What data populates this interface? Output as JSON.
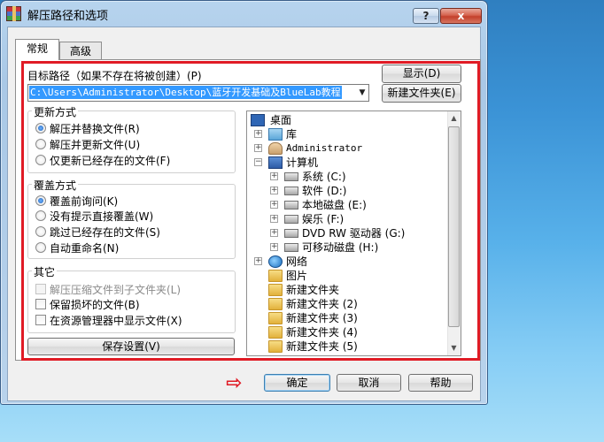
{
  "window": {
    "title": "解压路径和选项",
    "help_btn": "?",
    "close_btn": "x"
  },
  "tabs": [
    {
      "label": "常规",
      "active": true
    },
    {
      "label": "高级",
      "active": false
    }
  ],
  "target": {
    "label": "目标路径（如果不存在将被创建）(P)",
    "path": "C:\\Users\\Administrator\\Desktop\\蓝牙开发基础及BlueLab教程",
    "show_btn": "显示(D)",
    "new_folder_btn": "新建文件夹(E)"
  },
  "update_mode": {
    "title": "更新方式",
    "options": [
      {
        "label": "解压并替换文件(R)",
        "selected": true
      },
      {
        "label": "解压并更新文件(U)",
        "selected": false
      },
      {
        "label": "仅更新已经存在的文件(F)",
        "selected": false
      }
    ]
  },
  "overwrite_mode": {
    "title": "覆盖方式",
    "options": [
      {
        "label": "覆盖前询问(K)",
        "selected": true
      },
      {
        "label": "没有提示直接覆盖(W)",
        "selected": false
      },
      {
        "label": "跳过已经存在的文件(S)",
        "selected": false
      },
      {
        "label": "自动重命名(N)",
        "selected": false
      }
    ]
  },
  "misc": {
    "title": "其它",
    "options": [
      {
        "label": "解压压缩文件到子文件夹(L)",
        "disabled": true
      },
      {
        "label": "保留损坏的文件(B)",
        "disabled": false
      },
      {
        "label": "在资源管理器中显示文件(X)",
        "disabled": false
      }
    ]
  },
  "save_settings_btn": "保存设置(V)",
  "tree": [
    {
      "label": "桌面",
      "icon": "desktop-icon"
    },
    {
      "label": "库",
      "icon": "library-icon"
    },
    {
      "label": "Administrator",
      "icon": "user-folder-icon"
    },
    {
      "label": "计算机",
      "icon": "computer-icon"
    },
    {
      "label": "系统 (C:)",
      "icon": "drive-icon"
    },
    {
      "label": "软件 (D:)",
      "icon": "drive-icon"
    },
    {
      "label": "本地磁盘 (E:)",
      "icon": "drive-icon"
    },
    {
      "label": "娱乐 (F:)",
      "icon": "drive-icon"
    },
    {
      "label": "DVD RW 驱动器 (G:)",
      "icon": "dvd-drive-icon"
    },
    {
      "label": "可移动磁盘 (H:)",
      "icon": "removable-drive-icon"
    },
    {
      "label": "网络",
      "icon": "network-icon"
    },
    {
      "label": "图片",
      "icon": "folder-icon"
    },
    {
      "label": "新建文件夹",
      "icon": "folder-icon"
    },
    {
      "label": "新建文件夹 (2)",
      "icon": "folder-icon"
    },
    {
      "label": "新建文件夹 (3)",
      "icon": "folder-icon"
    },
    {
      "label": "新建文件夹 (4)",
      "icon": "folder-icon"
    },
    {
      "label": "新建文件夹 (5)",
      "icon": "folder-icon"
    }
  ],
  "footer": {
    "ok_btn": "确定",
    "cancel_btn": "取消",
    "help_btn": "帮助",
    "arrow_glyph": "⇨"
  },
  "colors": {
    "highlight": "#e01b25",
    "selection": "#3399ff"
  }
}
